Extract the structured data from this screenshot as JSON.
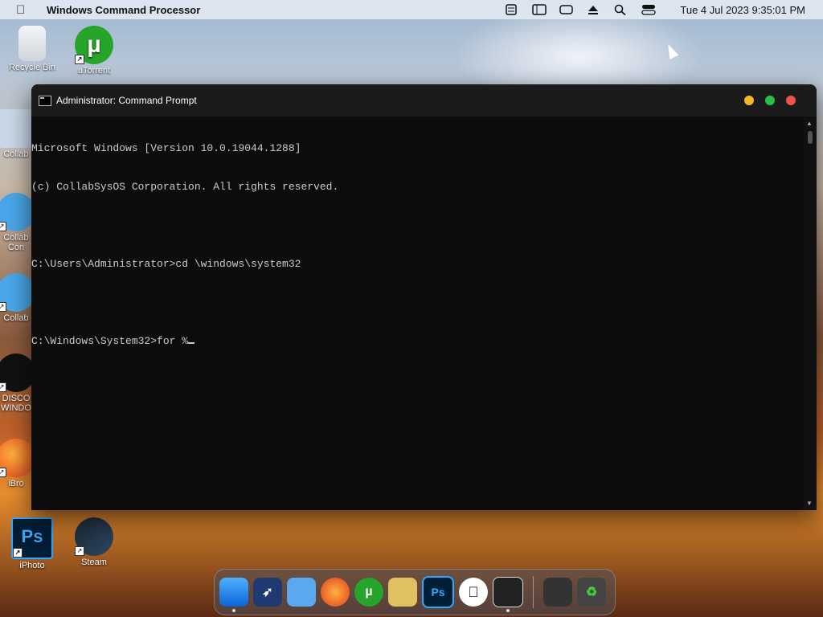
{
  "menubar": {
    "app_name": "Windows Command Processor",
    "clock": "Tue 4 Jul 2023  9:35:01 PM",
    "icons": [
      "cast-icon",
      "sidebar-icon",
      "battery-icon",
      "eject-icon",
      "search-icon",
      "control-center-icon"
    ]
  },
  "desktop": {
    "icons": [
      {
        "label": "Recycle Bin",
        "icon": "recycle-bin-icon"
      },
      {
        "label": "uTorrent",
        "icon": "utorrent-icon"
      },
      {
        "label": "Collab",
        "icon": "folder-icon"
      },
      {
        "label": "Collab Con",
        "icon": "ie-icon"
      },
      {
        "label": "Collab",
        "icon": "ie-icon"
      },
      {
        "label": "DISCO WINDO",
        "icon": "disco-icon"
      },
      {
        "label": "iBro",
        "icon": "firefox-icon"
      },
      {
        "label": "iPhoto",
        "icon": "photoshop-icon"
      },
      {
        "label": "Steam",
        "icon": "steam-icon"
      }
    ]
  },
  "window": {
    "title": "Administrator: Command Prompt",
    "lines": [
      "Microsoft Windows [Version 10.0.19044.1288]",
      "(c) CollabSysOS Corporation. All rights reserved.",
      "",
      "C:\\Users\\Administrator>cd \\windows\\system32",
      "",
      "C:\\Windows\\System32>for %"
    ]
  },
  "dock": {
    "items": [
      {
        "name": "finder-icon"
      },
      {
        "name": "launchpad-icon"
      },
      {
        "name": "files-icon"
      },
      {
        "name": "firefox-icon"
      },
      {
        "name": "utorrent-icon"
      },
      {
        "name": "preview-icon"
      },
      {
        "name": "photoshop-icon",
        "label": "Ps"
      },
      {
        "name": "apple-icon"
      },
      {
        "name": "terminal-icon"
      },
      {
        "name": "downloads-stack-icon"
      },
      {
        "name": "trash-icon"
      }
    ]
  },
  "colors": {
    "console_bg": "#0c0c0c",
    "console_text": "#cccccc",
    "titlebar_bg": "#1b1b1b"
  }
}
